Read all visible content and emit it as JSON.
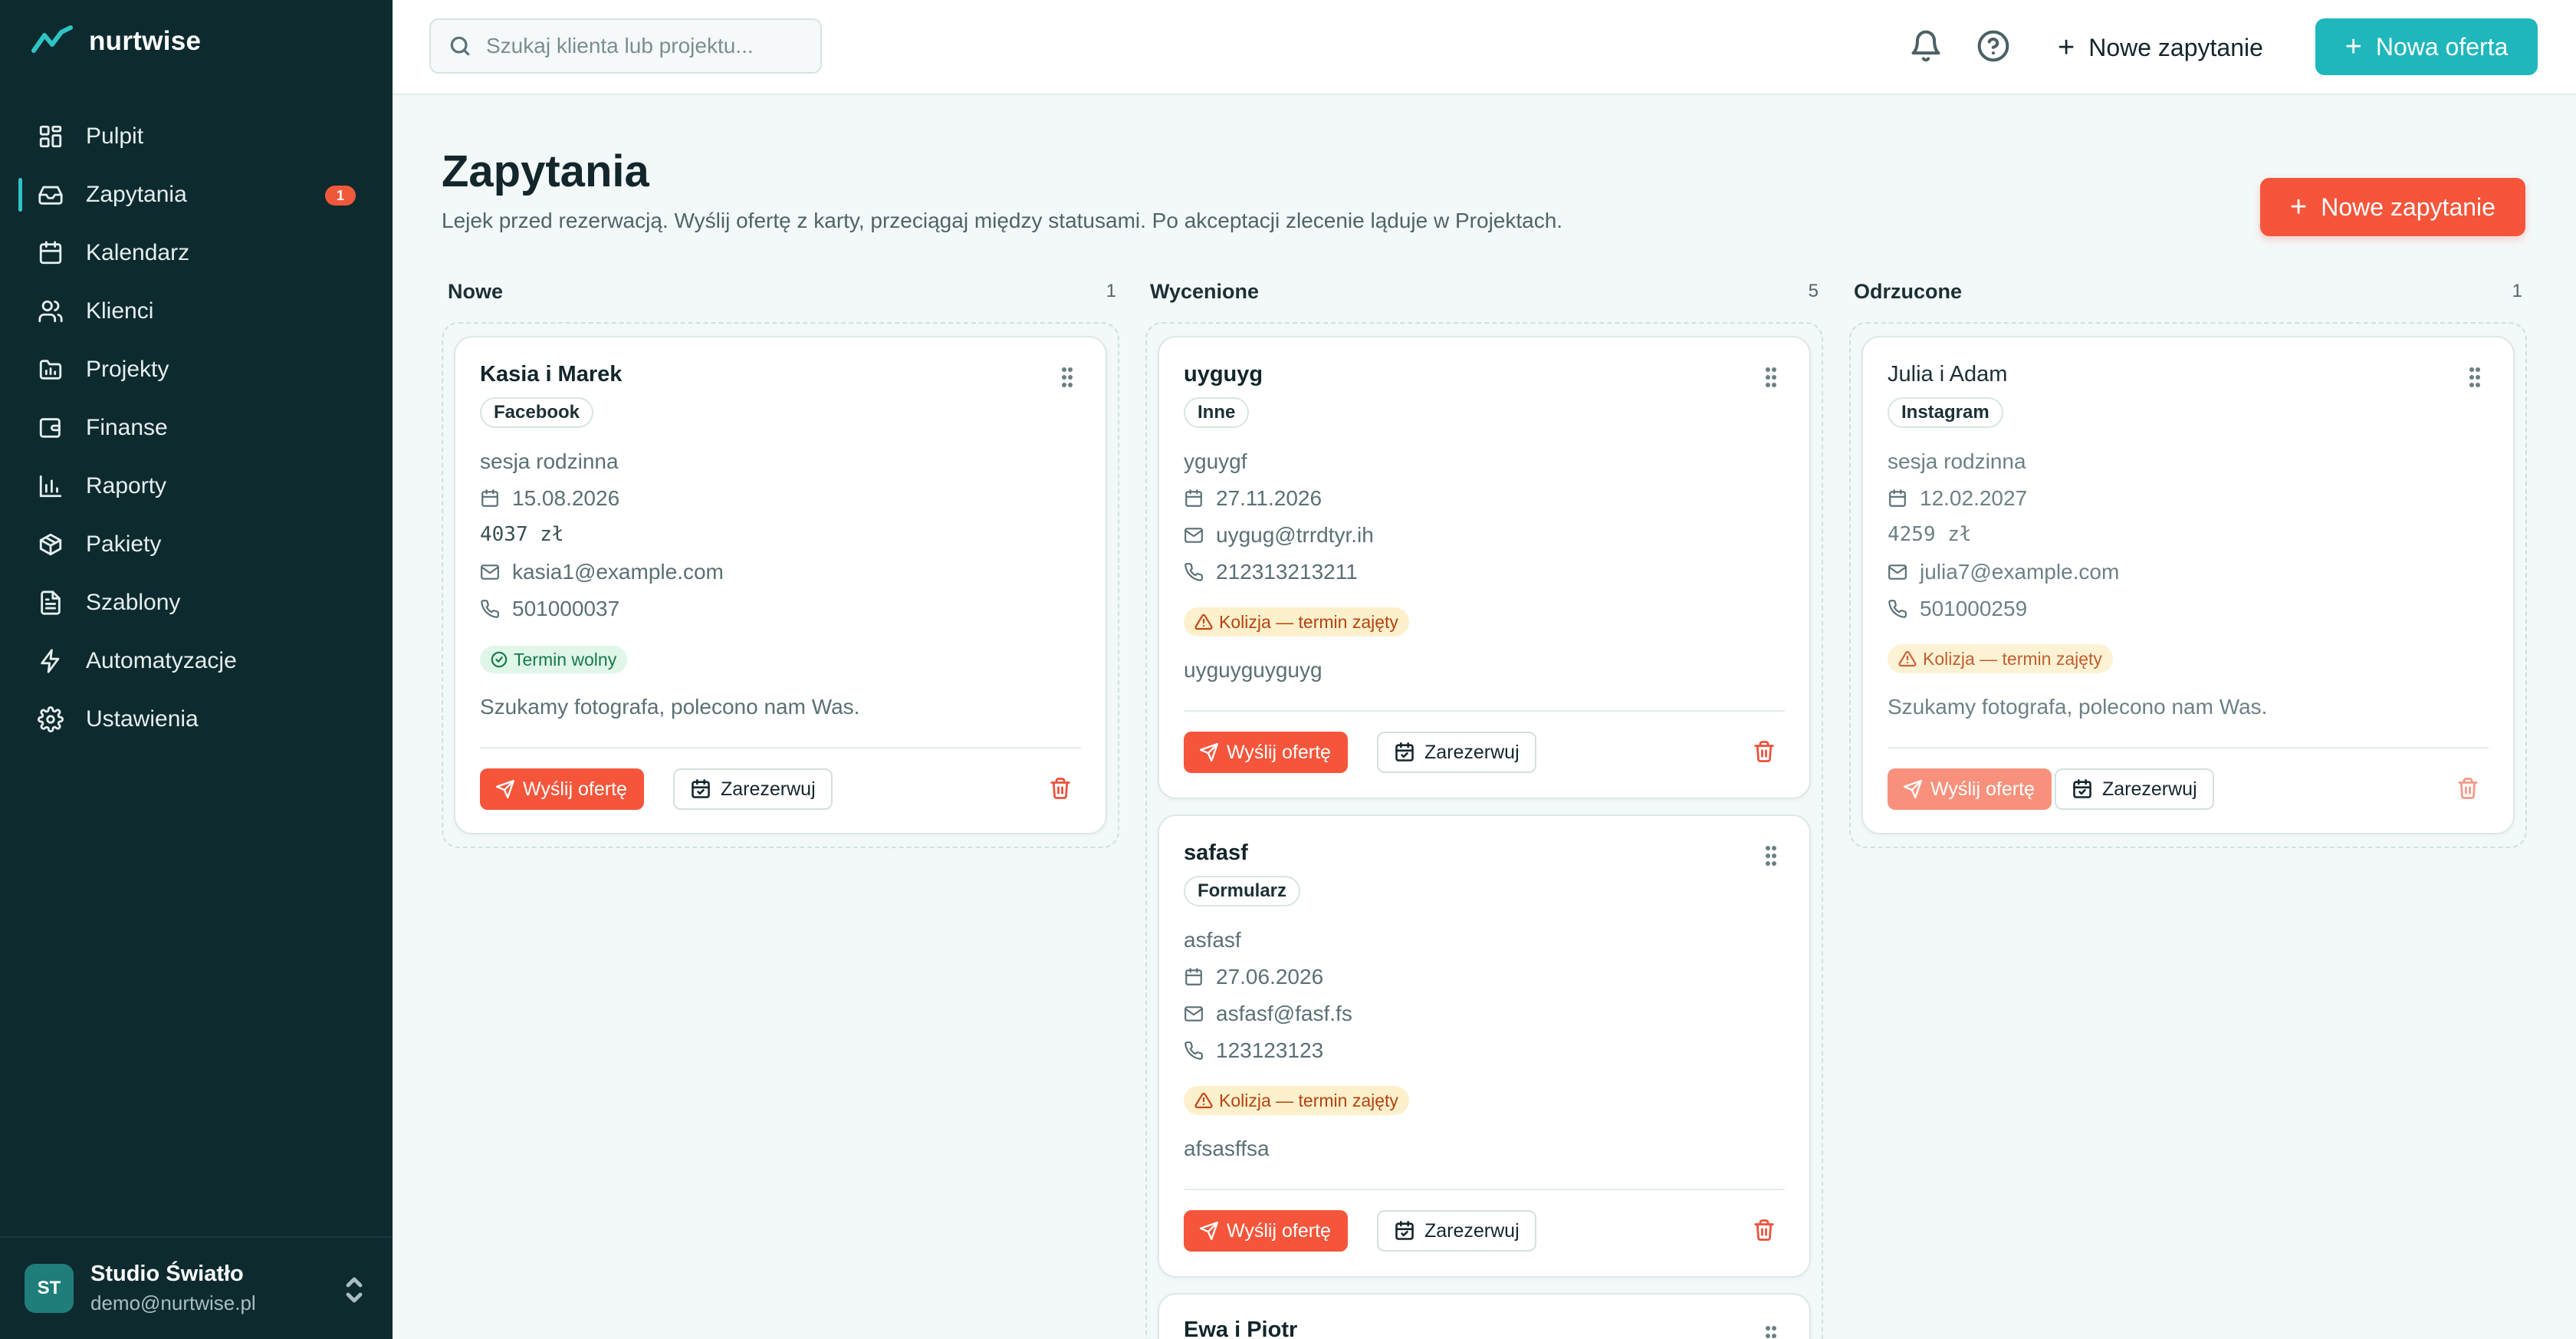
{
  "app": {
    "name": "nurtwise"
  },
  "sidebar": {
    "items": [
      {
        "label": "Pulpit",
        "icon": "dashboard-icon"
      },
      {
        "label": "Zapytania",
        "icon": "inbox-icon",
        "badge": "1",
        "active": true
      },
      {
        "label": "Kalendarz",
        "icon": "calendar-icon"
      },
      {
        "label": "Klienci",
        "icon": "users-icon"
      },
      {
        "label": "Projekty",
        "icon": "folder-icon"
      },
      {
        "label": "Finanse",
        "icon": "wallet-icon"
      },
      {
        "label": "Raporty",
        "icon": "bar-chart-icon"
      },
      {
        "label": "Pakiety",
        "icon": "package-icon"
      },
      {
        "label": "Szablony",
        "icon": "file-text-icon"
      },
      {
        "label": "Automatyzacje",
        "icon": "zap-icon"
      },
      {
        "label": "Ustawienia",
        "icon": "gear-icon"
      }
    ],
    "footer": {
      "initials": "ST",
      "name": "Studio Światło",
      "email": "demo@nurtwise.pl"
    }
  },
  "topbar": {
    "search_placeholder": "Szukaj klienta lub projektu...",
    "new_inquiry_label": "Nowe zapytanie",
    "new_offer_label": "Nowa oferta"
  },
  "page": {
    "title": "Zapytania",
    "subtitle": "Lejek przed rezerwacją. Wyślij ofertę z karty, przeciągaj między statusami. Po akceptacji zlecenie ląduje w Projektach.",
    "new_inquiry_label": "Nowe zapytanie"
  },
  "actions": {
    "send_offer": "Wyślij ofertę",
    "book": "Zarezerwuj"
  },
  "columns": [
    {
      "title": "Nowe",
      "count": "1",
      "cards": [
        {
          "name": "Kasia i Marek",
          "source": "Facebook",
          "type": "sesja rodzinna",
          "date": "15.08.2026",
          "price": "4037 zł",
          "email": "kasia1@example.com",
          "phone": "501000037",
          "status": "Termin wolny",
          "note": "Szukamy fotografa, polecono nam Was."
        }
      ]
    },
    {
      "title": "Wycenione",
      "count": "5",
      "cards": [
        {
          "name": "uyguyg",
          "source": "Inne",
          "type": "yguygf",
          "date": "27.11.2026",
          "email": "uygug@trrdtyr.ih",
          "phone": "212313213211",
          "status": "Kolizja — termin zajęty",
          "note": "uyguyguyguyg"
        },
        {
          "name": "safasf",
          "source": "Formularz",
          "type": "asfasf",
          "date": "27.06.2026",
          "email": "asfasf@fasf.fs",
          "phone": "123123123",
          "status": "Kolizja — termin zajęty",
          "note": "afsasffsa"
        },
        {
          "name": "Ewa i Piotr"
        }
      ]
    },
    {
      "title": "Odrzucone",
      "count": "1",
      "cards": [
        {
          "name": "Julia i Adam",
          "source": "Instagram",
          "type": "sesja rodzinna",
          "date": "12.02.2027",
          "price": "4259 zł",
          "email": "julia7@example.com",
          "phone": "501000259",
          "status": "Kolizja — termin zajęty",
          "note": "Szukamy fotografa, polecono nam Was."
        }
      ]
    }
  ],
  "colors": {
    "sidebar_bg": "#0d2a2f",
    "accent_teal": "#1fb7bb",
    "accent_orange": "#f5553a",
    "badge": "#f0583c"
  }
}
